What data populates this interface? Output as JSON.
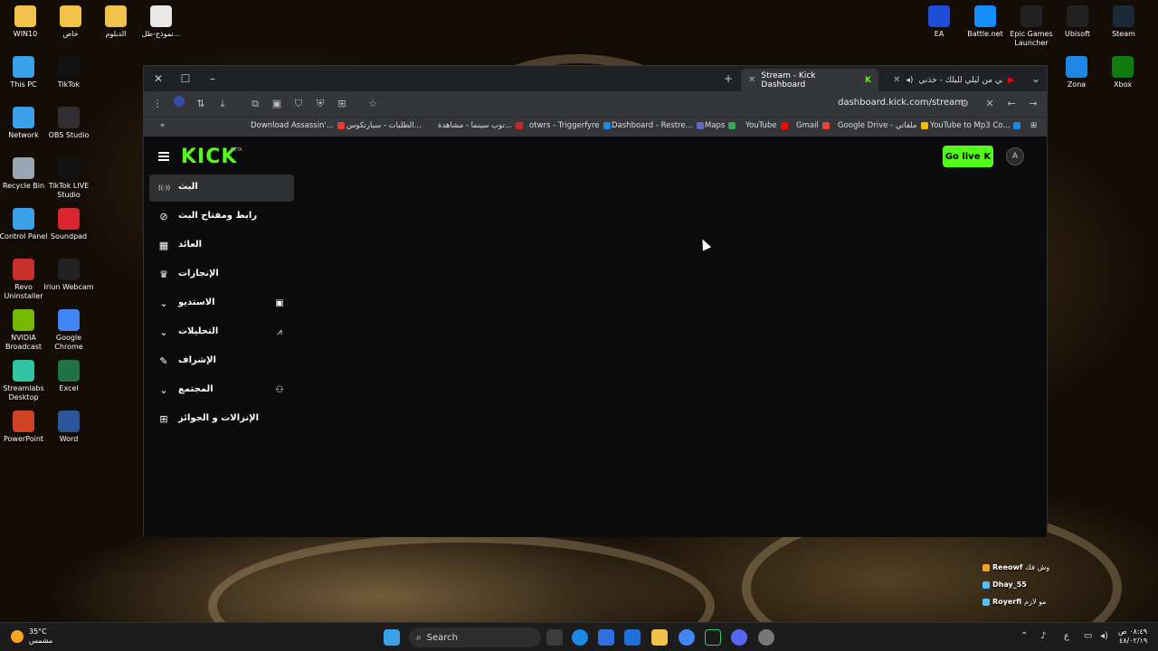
{
  "desktop": {
    "left_icons": [
      {
        "label": "WIN10",
        "icon": "folder-icon",
        "color": "#f0c24a"
      },
      {
        "label": "خاص",
        "icon": "folder-icon",
        "color": "#f0c24a"
      },
      {
        "label": "الدبلوم",
        "icon": "folder-icon",
        "color": "#f0c24a"
      },
      {
        "label": "نموذج-طل...",
        "icon": "chrome-doc-icon",
        "color": "#e8e8e8"
      },
      {
        "label": "This PC",
        "icon": "monitor-icon",
        "color": "#3aa0e8"
      },
      {
        "label": "TikTok",
        "icon": "tiktok-icon",
        "color": "#111111"
      },
      {
        "label": "Network",
        "icon": "network-icon",
        "color": "#3aa0e8"
      },
      {
        "label": "OBS Studio",
        "icon": "obs-icon",
        "color": "#302e31"
      },
      {
        "label": "Recycle Bin",
        "icon": "recycle-bin-icon",
        "color": "#9aa6b2"
      },
      {
        "label": "TikTok LIVE Studio",
        "icon": "tiktok-live-icon",
        "color": "#111111"
      },
      {
        "label": "Control Panel",
        "icon": "control-panel-icon",
        "color": "#3aa0e8"
      },
      {
        "label": "Soundpad",
        "icon": "soundpad-icon",
        "color": "#d9262e"
      },
      {
        "label": "Revo Uninstaller",
        "icon": "revo-icon",
        "color": "#c9302c"
      },
      {
        "label": "Iriun Webcam",
        "icon": "webcam-icon",
        "color": "#222222"
      },
      {
        "label": "NVIDIA Broadcast",
        "icon": "nvidia-icon",
        "color": "#76b900"
      },
      {
        "label": "Google Chrome",
        "icon": "chrome-icon",
        "color": "#4285f4"
      },
      {
        "label": "Streamlabs Desktop",
        "icon": "streamlabs-icon",
        "color": "#31c3a2"
      },
      {
        "label": "Excel",
        "icon": "excel-icon",
        "color": "#1f7244"
      },
      {
        "label": "PowerPoint",
        "icon": "powerpoint-icon",
        "color": "#d04423"
      },
      {
        "label": "Word",
        "icon": "word-icon",
        "color": "#2b579a"
      }
    ],
    "right_icons": [
      {
        "label": "EA",
        "icon": "ea-icon",
        "color": "#1d4ed8"
      },
      {
        "label": "Battle.net",
        "icon": "battlenet-icon",
        "color": "#148eff"
      },
      {
        "label": "Epic Games Launcher",
        "icon": "epic-games-icon",
        "color": "#222222"
      },
      {
        "label": "Ubisoft",
        "icon": "ubisoft-icon",
        "color": "#222222"
      },
      {
        "label": "Steam",
        "icon": "steam-icon",
        "color": "#1b2838"
      },
      {
        "label": "Zona",
        "icon": "zona-icon",
        "color": "#1e88e5"
      },
      {
        "label": "Xbox",
        "icon": "xbox-icon",
        "color": "#107c10"
      }
    ]
  },
  "browser": {
    "tabs": [
      {
        "title": "Stream - Kick Dashboard",
        "active": true
      },
      {
        "title": "خذني من ليلي لليلك - خذني...",
        "active": false
      }
    ],
    "url": "dashboard.kick.com/stream",
    "bookmarks": [
      {
        "label": "Download Assassin'...",
        "color": "#e53935"
      },
      {
        "label": "الطلبات - سيارتكوس...",
        "color": "#333333"
      },
      {
        "label": "توب سينما - مشاهدة...",
        "color": "#c62828"
      },
      {
        "label": "otwrs - Triggerfyre",
        "color": "#1e88e5"
      },
      {
        "label": "Dashboard - Restre...",
        "color": "#5c6bc0"
      },
      {
        "label": "Maps",
        "color": "#34a853"
      },
      {
        "label": "YouTube",
        "color": "#ff0000"
      },
      {
        "label": "Gmail",
        "color": "#ea4335"
      },
      {
        "label": "Google Drive - ملفاتي",
        "color": "#fbbc05"
      },
      {
        "label": "YouTube to Mp3 Co...",
        "color": "#1e88e5"
      }
    ]
  },
  "kick": {
    "logo": "KICK",
    "beta": "BETA",
    "go_live": "Go live",
    "avatar_initial": "A",
    "nav": [
      {
        "label": "البث",
        "icon": "broadcast-icon",
        "active": true,
        "expand": false,
        "side_icon": ""
      },
      {
        "label": "رابط ومفتاح البث",
        "icon": "link-icon",
        "active": false,
        "expand": false,
        "side_icon": ""
      },
      {
        "label": "العائد",
        "icon": "chart-icon",
        "active": false,
        "expand": false,
        "side_icon": ""
      },
      {
        "label": "الإنجازات",
        "icon": "trophy-icon",
        "active": false,
        "expand": false,
        "side_icon": ""
      },
      {
        "label": "الاستديو",
        "icon": "chevron-down-icon",
        "active": false,
        "expand": true,
        "side_icon": "studio-icon"
      },
      {
        "label": "التحليلات",
        "icon": "chevron-down-icon",
        "active": false,
        "expand": true,
        "side_icon": "analytics-icon"
      },
      {
        "label": "الإشراف",
        "icon": "wrench-icon",
        "active": false,
        "expand": false,
        "side_icon": ""
      },
      {
        "label": "المجتمع",
        "icon": "chevron-down-icon",
        "active": false,
        "expand": true,
        "side_icon": "community-icon"
      },
      {
        "label": "الإنزالات و الجوائز",
        "icon": "gift-icon",
        "active": false,
        "expand": false,
        "side_icon": ""
      }
    ]
  },
  "chat_overlay": [
    {
      "user": "Reeowf",
      "message": "وش فك",
      "color": "#f5a623"
    },
    {
      "user": "Dhay_55",
      "message": "",
      "color": "#4fc3f7"
    },
    {
      "user": "Royerfi",
      "message": "مو لازم",
      "color": "#4fc3f7"
    }
  ],
  "taskbar": {
    "weather_temp": "35°C",
    "weather_desc": "مشمس",
    "search_placeholder": "Search",
    "lang": "ع",
    "time": "٠٨:٤٩ ص",
    "date": "٤٨/٠٢/١٩"
  }
}
